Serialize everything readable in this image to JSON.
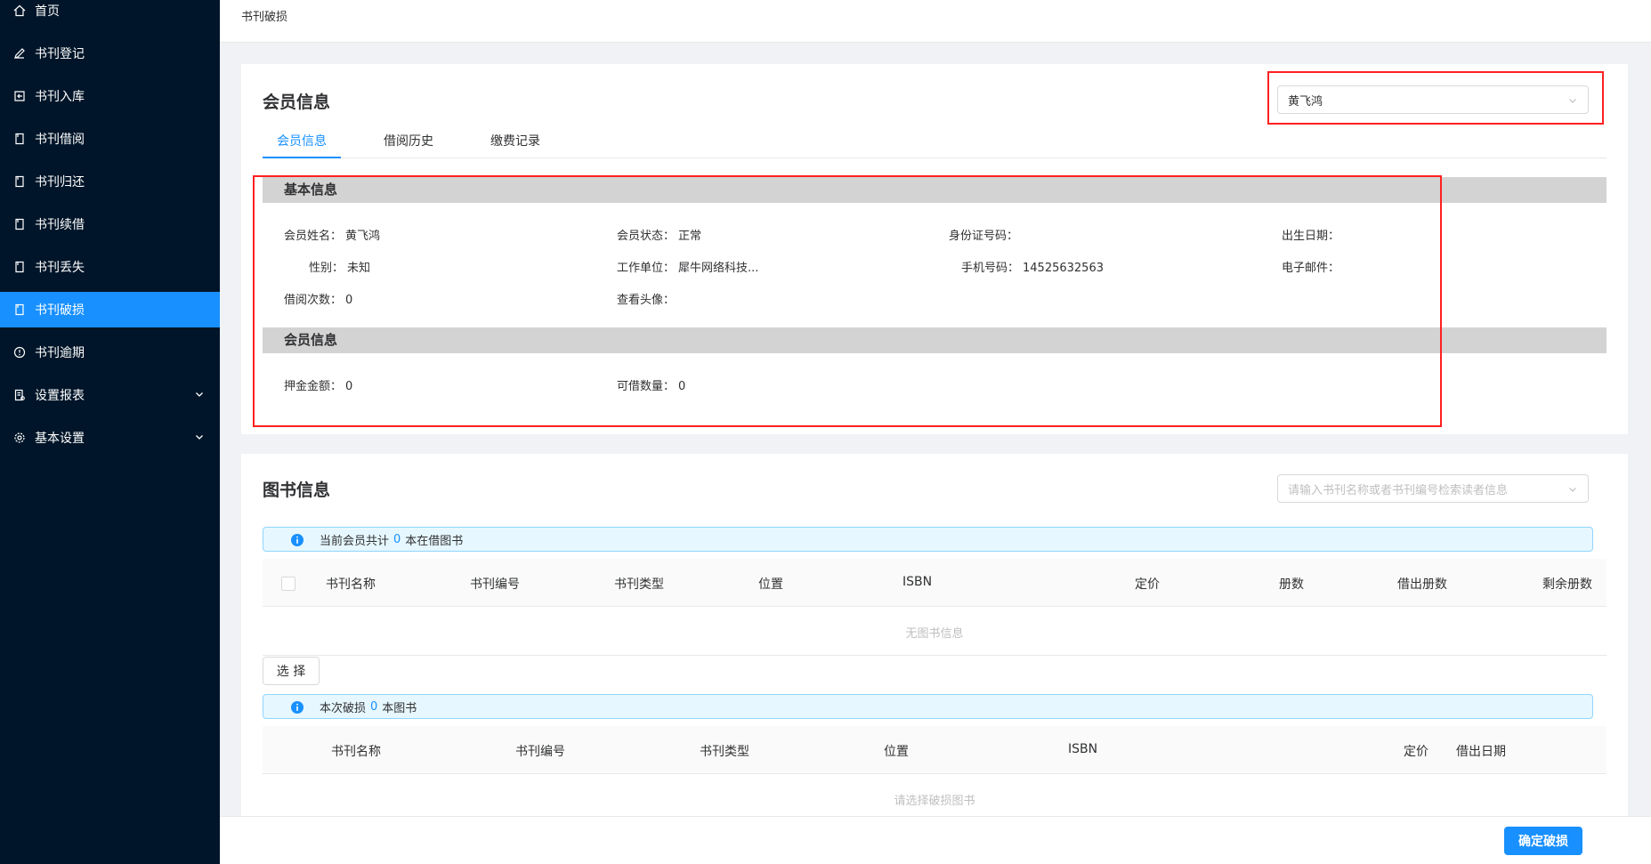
{
  "sidebar": {
    "items": [
      {
        "label": "首页",
        "icon": "home-icon"
      },
      {
        "label": "书刊登记",
        "icon": "pen-icon"
      },
      {
        "label": "书刊入库",
        "icon": "import-icon"
      },
      {
        "label": "书刊借阅",
        "icon": "book-icon"
      },
      {
        "label": "书刊归还",
        "icon": "book-icon"
      },
      {
        "label": "书刊续借",
        "icon": "book-icon"
      },
      {
        "label": "书刊丢失",
        "icon": "book-icon"
      },
      {
        "label": "书刊破损",
        "icon": "book-icon",
        "active": true
      },
      {
        "label": "书刊逾期",
        "icon": "clock-icon"
      },
      {
        "label": "设置报表",
        "icon": "report-icon",
        "expandable": true
      },
      {
        "label": "基本设置",
        "icon": "gear-icon",
        "expandable": true
      }
    ]
  },
  "breadcrumb": "书刊破损",
  "member_card": {
    "title": "会员信息",
    "member_select": "黄飞鸿",
    "tabs": [
      "会员信息",
      "借阅历史",
      "缴费记录"
    ],
    "basic_section": "基本信息",
    "fields": {
      "name_label": "会员姓名：",
      "name_value": "黄飞鸿",
      "status_label": "会员状态：",
      "status_value": "正常",
      "id_label": "身份证号码：",
      "id_value": "",
      "birth_label": "出生日期：",
      "birth_value": "",
      "gender_label": "性别：",
      "gender_value": "未知",
      "work_label": "工作单位：",
      "work_value": "犀牛网络科技...",
      "phone_label": "手机号码：",
      "phone_value": "14525632563",
      "email_label": "电子邮件：",
      "email_value": "",
      "borrow_count_label": "借阅次数：",
      "borrow_count_value": "0",
      "avatar_label": "查看头像：",
      "avatar_value": ""
    },
    "member_section": "会员信息",
    "member_fields": {
      "deposit_label": "押金金额：",
      "deposit_value": "0",
      "quota_label": "可借数量：",
      "quota_value": "0"
    }
  },
  "book_card": {
    "title": "图书信息",
    "search_placeholder": "请输入书刊名称或者书刊编号检索读者信息",
    "info1": {
      "prefix": "当前会员共计",
      "count": "0",
      "suffix": "本在借图书"
    },
    "table1_headers": [
      "书刊名称",
      "书刊编号",
      "书刊类型",
      "位置",
      "ISBN",
      "定价",
      "册数",
      "借出册数",
      "剩余册数"
    ],
    "table1_empty": "无图书信息",
    "select_button": "选 择",
    "info2": {
      "prefix": "本次破损",
      "count": "0",
      "suffix": "本图书"
    },
    "table2_headers": [
      "书刊名称",
      "书刊编号",
      "书刊类型",
      "位置",
      "ISBN",
      "定价",
      "借出日期"
    ],
    "table2_empty": "请选择破损图书"
  },
  "footer": {
    "confirm_button": "确定破损"
  },
  "colors": {
    "sidebar_bg": "#001529",
    "accent": "#1890ff",
    "highlight_border": "#ff2020"
  }
}
